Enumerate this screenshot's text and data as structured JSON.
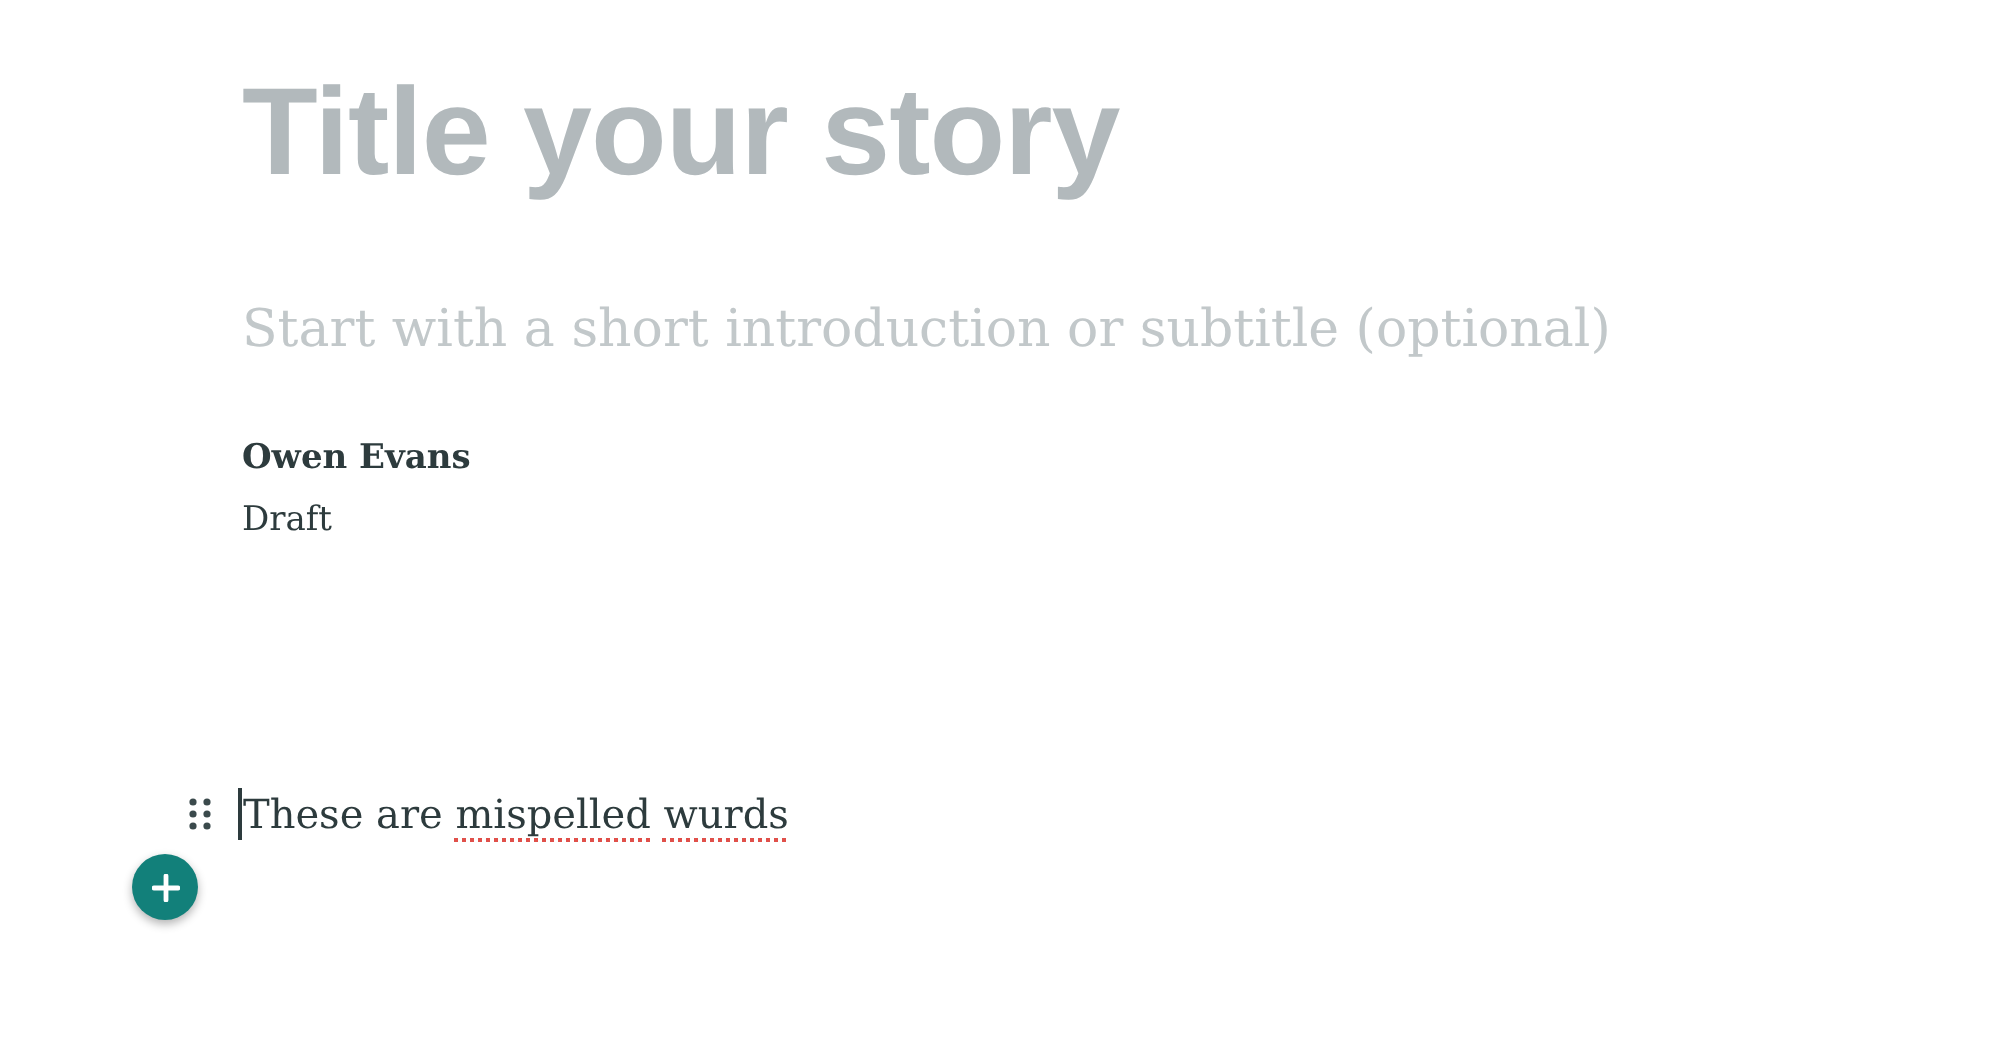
{
  "title_field": {
    "placeholder": "Title your story"
  },
  "subtitle_field": {
    "placeholder": "Start with a short introduction or subtitle (optional)"
  },
  "author": {
    "name": "Owen Evans",
    "status": "Draft"
  },
  "body": {
    "focused": true,
    "segments": [
      {
        "text": "These are",
        "misspelled": false
      },
      {
        "text": "mispelled",
        "misspelled": true
      },
      {
        "text": "wurds",
        "misspelled": true
      }
    ]
  }
}
